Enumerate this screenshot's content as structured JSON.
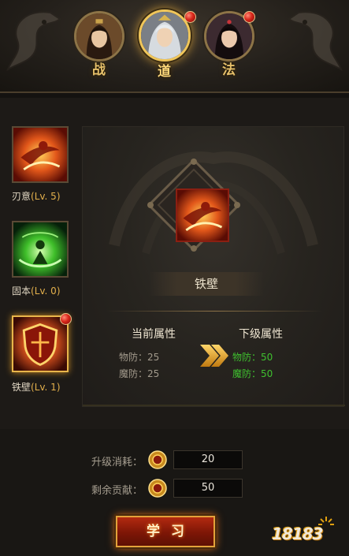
{
  "header": {
    "classes": [
      {
        "label": "战",
        "active": false
      },
      {
        "label": "道",
        "active": true
      },
      {
        "label": "法",
        "active": false
      }
    ]
  },
  "skills": [
    {
      "name": "刃意",
      "level": "(Lv. 5)"
    },
    {
      "name": "固本",
      "level": "(Lv. 0)"
    },
    {
      "name": "铁壁",
      "level": "(Lv. 1)",
      "selected": true
    }
  ],
  "detail": {
    "skill_name": "铁壁",
    "current_header": "当前属性",
    "next_header": "下级属性",
    "current_attrs": [
      "物防：25",
      "魔防：25"
    ],
    "next_attrs": [
      "物防：50",
      "魔防：50"
    ]
  },
  "cost": {
    "upgrade_label": "升级消耗：",
    "upgrade_value": "20",
    "remaining_label": "剩余贡献：",
    "remaining_value": "50"
  },
  "learn_button": "学习",
  "watermark": "18183",
  "colors": {
    "gold": "#e3b04c",
    "next_green": "#3fc02f",
    "button_red": "#9a1f0a"
  }
}
